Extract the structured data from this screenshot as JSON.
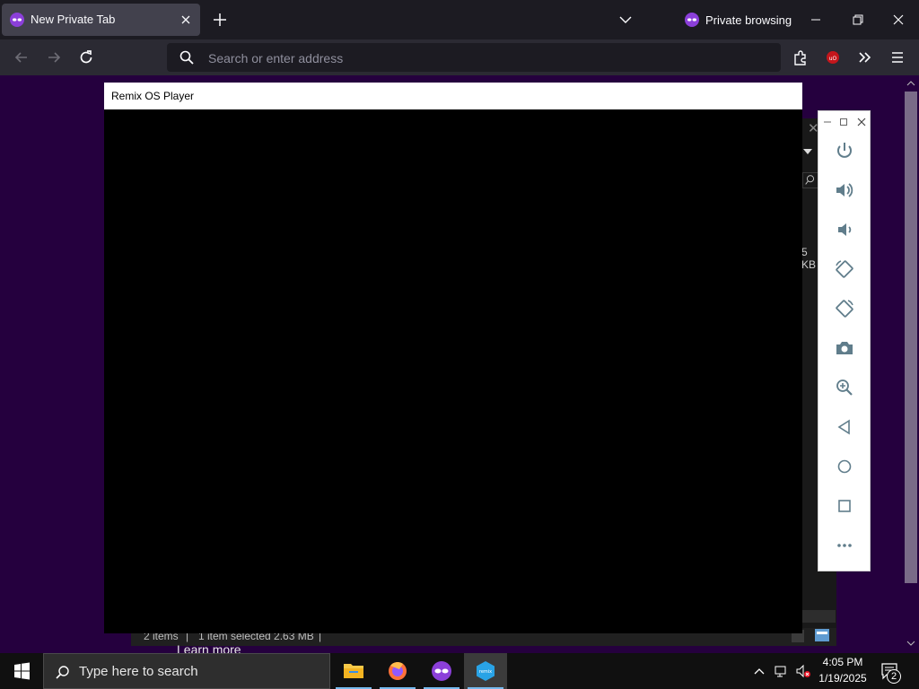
{
  "browser": {
    "tab": {
      "title": "New Private Tab",
      "icon": "private-mask-icon"
    },
    "private_label": "Private browsing",
    "urlbar": {
      "placeholder": "Search or enter address"
    }
  },
  "remix_player": {
    "title": "Remix OS Player",
    "panel_buttons": [
      "power-icon",
      "volume-up-icon",
      "volume-down-icon",
      "rotate-left-icon",
      "rotate-right-icon",
      "camera-icon",
      "zoom-in-icon",
      "back-icon",
      "home-icon",
      "recents-icon",
      "more-icon"
    ]
  },
  "explorer": {
    "size_fragment": "5 KB",
    "status": {
      "items": "2 items",
      "separator": "|",
      "selected": "1 item selected  2.63 MB"
    }
  },
  "page": {
    "learn_more": "Learn more"
  },
  "taskbar": {
    "search_placeholder": "Type here to search",
    "apps": [
      "file-explorer-icon",
      "firefox-icon",
      "firefox-private-icon",
      "remix-os-icon"
    ],
    "clock": {
      "time": "4:05 PM",
      "date": "1/19/2025"
    },
    "notification_count": "2"
  },
  "colors": {
    "page_bg": "#25003e",
    "tabbar_bg": "#1c1b22",
    "navbar_bg": "#2b2a33",
    "accent": "#76b9ed"
  }
}
